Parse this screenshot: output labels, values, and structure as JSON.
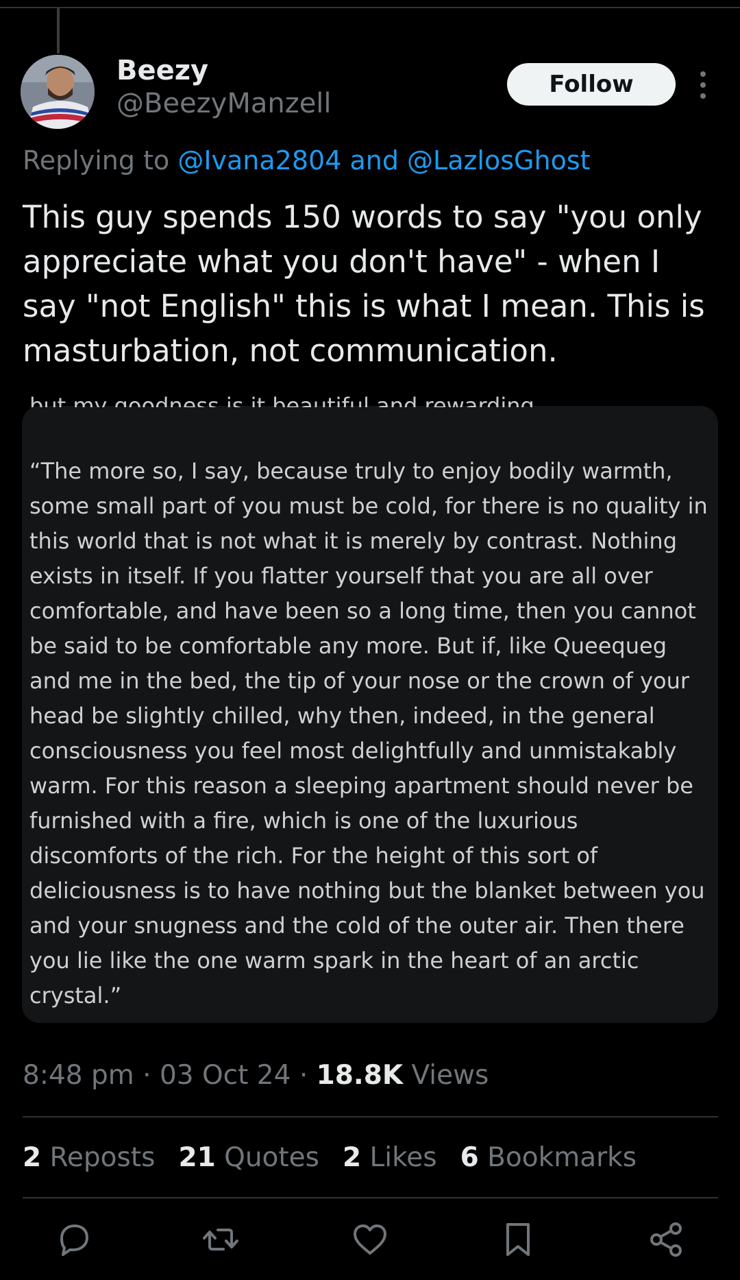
{
  "author": {
    "name": "Beezy",
    "handle": "@BeezyManzell",
    "avatar_icon": "profile-photo"
  },
  "follow_label": "Follow",
  "reply": {
    "prefix": "Replying to ",
    "mention1": "@Ivana2804",
    "conjunction": " and ",
    "mention2": "@LazlosGhost"
  },
  "tweet_text": "This guy spends 150 words to say \"you only appreciate what you don't have\" - when I say \"not English\" this is what I mean. This is masturbation, not communication.",
  "media": {
    "top_line": "but my goodness is it beautiful and rewarding.",
    "paragraph": "“The more so, I say, because truly to enjoy bodily warmth,\nsome small part of you must be cold, for there is no quality in\nthis world that is not what it is merely by contrast. Nothing\nexists in itself. If you flatter yourself that you are all over\ncomfortable, and have been so a long time, then you cannot\nbe said to be comfortable any more. But if, like Queequeg\nand me in the bed, the tip of your nose or the crown of your\nhead be slightly chilled, why then, indeed, in the general\nconsciousness you feel most delightfully and unmistakably\nwarm. For this reason a sleeping apartment should never be\nfurnished with a fire, which is one of the luxurious\ndiscomforts of the rich. For the height of this sort of\ndeliciousness is to have nothing but the blanket between you\nand your snugness and the cold of the outer air. Then there\nyou lie like the one warm spark in the heart of an arctic\ncrystal.”"
  },
  "meta": {
    "time": "8:48 pm",
    "sep": " · ",
    "date": "03 Oct 24",
    "views_count": "18.8K",
    "views_label": " Views"
  },
  "stats": {
    "reposts_count": "2",
    "reposts_label": " Reposts",
    "quotes_count": "21",
    "quotes_label": " Quotes",
    "likes_count": "2",
    "likes_label": " Likes",
    "bookmarks_count": "6",
    "bookmarks_label": " Bookmarks"
  },
  "colors": {
    "background": "#000000",
    "text": "#e7e9ea",
    "secondary": "#71767b",
    "link": "#1d9bf0",
    "media_bg": "#141516"
  },
  "action_icons": [
    "reply-icon",
    "repost-icon",
    "like-icon",
    "bookmark-icon",
    "share-icon"
  ]
}
